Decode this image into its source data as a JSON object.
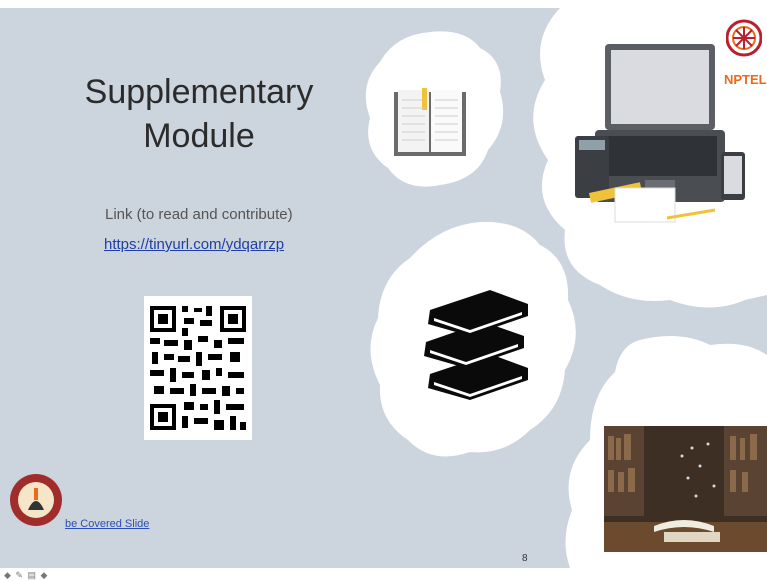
{
  "slide": {
    "title_line1": "Supplementary",
    "title_line2": "Module",
    "link_caption": "Link (to read and contribute)",
    "url": "https://tinyurl.com/ydqarrzp",
    "toc_link": "be Covered Slide",
    "slide_number": "8"
  },
  "branding": {
    "nptel_label": "NPTEL"
  },
  "viewer": {
    "nav_controls": "◆ ✎ ▤ ◆"
  },
  "colors": {
    "background": "#ccd4de",
    "link": "#1f3fa6",
    "nptel_orange": "#e86a1a"
  }
}
